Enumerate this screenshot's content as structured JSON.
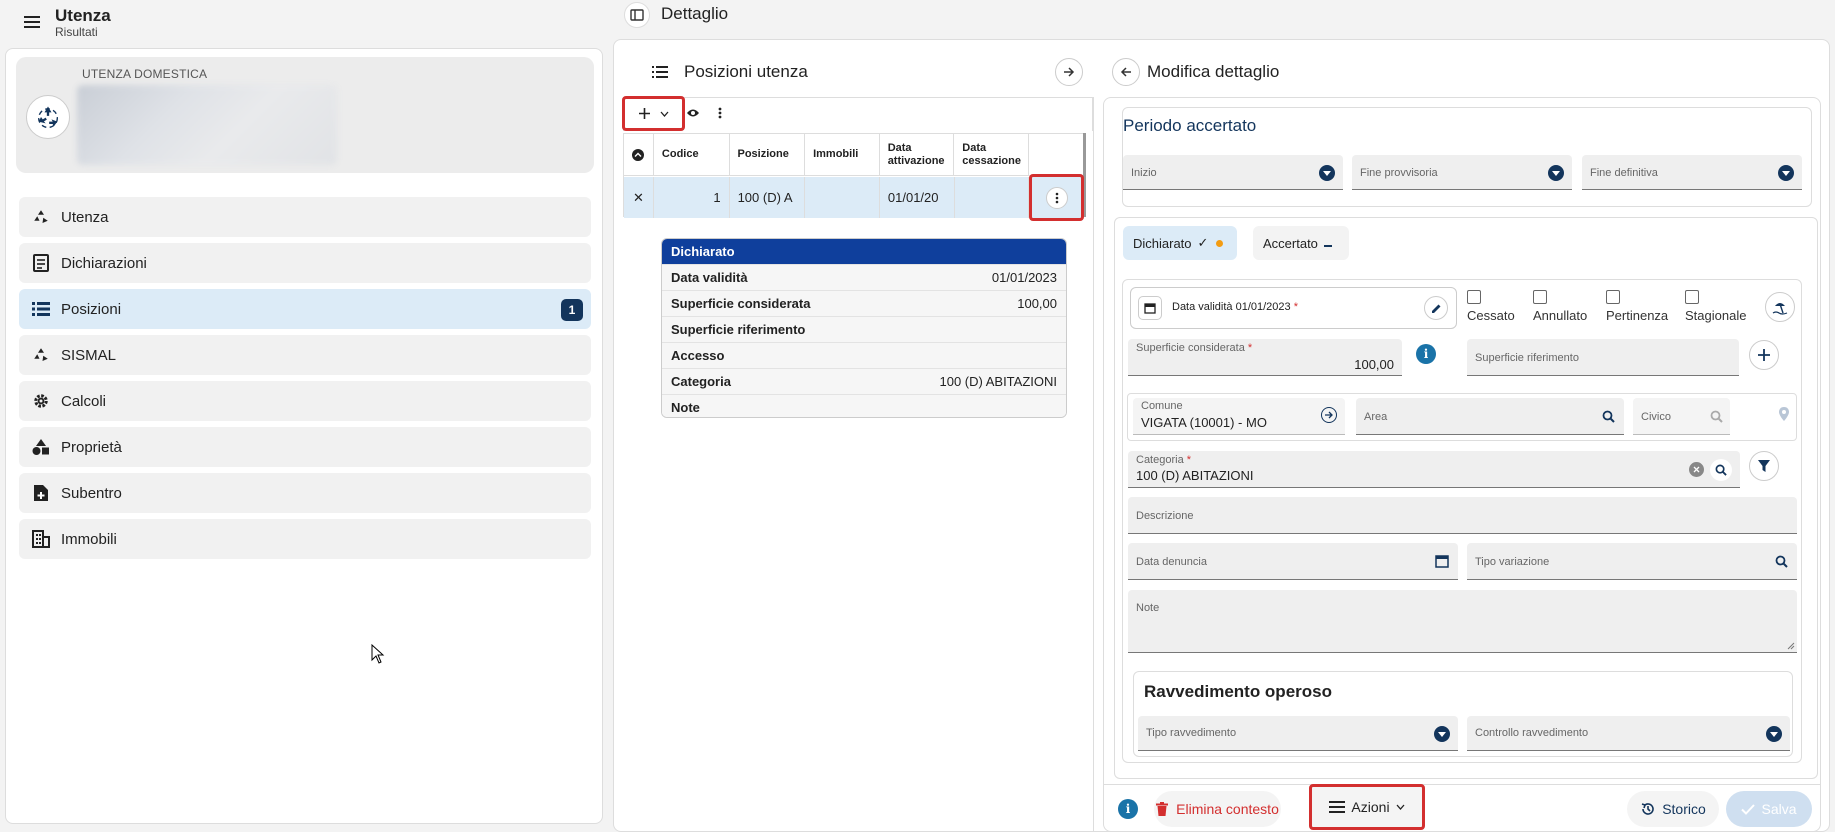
{
  "left_header": {
    "title": "Utenza",
    "subtitle": "Risultati"
  },
  "detail_header": {
    "title": "Dettaglio"
  },
  "user_card": {
    "type": "UTENZA DOMESTICA"
  },
  "nav": [
    {
      "label": "Utenza",
      "icon": "recycle-icon"
    },
    {
      "label": "Dichiarazioni",
      "icon": "document-icon"
    },
    {
      "label": "Posizioni",
      "icon": "list-icon",
      "badge": "1"
    },
    {
      "label": "SISMAL",
      "icon": "recycle-icon"
    },
    {
      "label": "Calcoli",
      "icon": "gear-icon"
    },
    {
      "label": "Proprietà",
      "icon": "shapes-icon"
    },
    {
      "label": "Subentro",
      "icon": "file-plus-icon"
    },
    {
      "label": "Immobili",
      "icon": "building-icon"
    }
  ],
  "positions": {
    "title": "Posizioni utenza",
    "columns": [
      "Codice",
      "Posizione",
      "Immobili",
      "Data attivazione",
      "Data cessazione"
    ],
    "row": {
      "close": "✕",
      "codice": "1",
      "posizione": "100 (D) A",
      "immobili": "",
      "data_attivazione": "01/01/20",
      "data_cessazione": ""
    }
  },
  "summary": {
    "title": "Dichiarato",
    "rows": [
      {
        "k": "Data validità",
        "v": "01/01/2023"
      },
      {
        "k": "Superficie considerata",
        "v": "100,00"
      },
      {
        "k": "Superficie riferimento",
        "v": ""
      },
      {
        "k": "Accesso",
        "v": ""
      },
      {
        "k": "Categoria",
        "v": "100 (D) ABITAZIONI"
      },
      {
        "k": "Note",
        "v": ""
      }
    ]
  },
  "form": {
    "title": "Modifica dettaglio",
    "periodo": {
      "title": "Periodo accertato",
      "inizio": "Inizio",
      "fine_provvisoria": "Fine provvisoria",
      "fine_definitiva": "Fine definitiva"
    },
    "tabs": {
      "dichiarato": "Dichiarato",
      "dichiarato_check": "✓",
      "accertato": "Accertato"
    },
    "data_validita": "Data validità 01/01/2023",
    "checkboxes": [
      "Cessato",
      "Annullato",
      "Pertinenza",
      "Stagionale"
    ],
    "sup_considerata": {
      "label": "Superficie considerata",
      "value": "100,00"
    },
    "sup_riferimento": {
      "label": "Superficie riferimento"
    },
    "comune": {
      "label": "Comune",
      "value": "VIGATA (10001) - MO"
    },
    "area": {
      "label": "Area"
    },
    "civico": {
      "label": "Civico"
    },
    "categoria": {
      "label": "Categoria",
      "value": "100 (D) ABITAZIONI"
    },
    "descrizione": {
      "label": "Descrizione"
    },
    "data_denuncia": {
      "label": "Data denuncia"
    },
    "tipo_variazione": {
      "label": "Tipo variazione"
    },
    "note": {
      "label": "Note"
    },
    "ravvedimento": {
      "title": "Ravvedimento operoso",
      "tipo": "Tipo ravvedimento",
      "controllo": "Controllo ravvedimento"
    }
  },
  "footer": {
    "elimina": "Elimina contesto",
    "azioni": "Azioni",
    "storico": "Storico",
    "salva": "Salva"
  },
  "colors": {
    "primary": "#13355c",
    "accent_blue": "#0f3f9c",
    "active_bg": "#dcebf7",
    "danger": "#d32f2f",
    "warning_dot": "#f39c12"
  }
}
